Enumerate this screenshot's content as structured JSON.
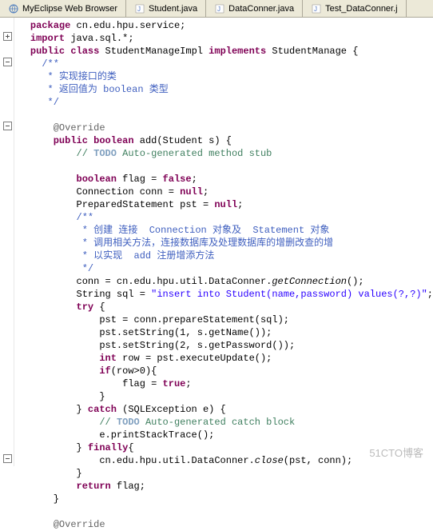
{
  "tabs": [
    {
      "label": "MyEclipse Web Browser"
    },
    {
      "label": "Student.java"
    },
    {
      "label": "DataConner.java"
    },
    {
      "label": "Test_DataConner.j"
    }
  ],
  "code": {
    "l1": {
      "kw": "package",
      "rest": " cn.edu.hpu.service;"
    },
    "l2": {
      "sym": "⊕",
      "kw": "import",
      "rest": " java.sql.*;"
    },
    "l3": {
      "kw1": "public",
      "kw2": "class",
      "name": " StudentManageImpl ",
      "kw3": "implements",
      "rest": " StudentManage {"
    },
    "jd1": "/**",
    "jd2": " * 实现接口的类",
    "jd3_a": " * 返回值为 ",
    "jd3_b": "boolean 类型",
    "jd4": " */",
    "ann": "@Override",
    "m1_a": "public",
    "m1_b": " boolean",
    "m1_c": " add(Student s) {",
    "c1_a": "// ",
    "c1_b": "TODO",
    "c1_c": " Auto-generated method stub",
    "b1_a": "boolean",
    "b1_b": " flag = ",
    "b1_c": "false",
    "b1_d": ";",
    "b2_a": "Connection conn = ",
    "b2_b": "null",
    "b2_c": ";",
    "b3_a": "PreparedStatement pst = ",
    "b3_b": "null",
    "b3_c": ";",
    "jd5": "/**",
    "jd6_a": " * 创建 连接  ",
    "jd6_b": "Connection 对象及  Statement 对象",
    "jd7": " * 调用相关方法，连接数据库及处理数据库的增删改查的增",
    "jd8_a": " * 以实现  ",
    "jd8_b": "add 注册增添方法",
    "jd9": " */",
    "s1_a": "conn = cn.edu.hpu.util.DataConner.",
    "s1_b": "getConnection",
    "s1_c": "();",
    "s2_a": "String sql = ",
    "s2_b": "\"insert into Student(name,password) values(?,?)\"",
    "s2_c": ";",
    "s3_a": "try",
    "s3_b": " {",
    "s4": "pst = conn.prepareStatement(sql);",
    "s5": "pst.setString(1, s.getName());",
    "s6": "pst.setString(2, s.getPassword());",
    "s7_a": "int",
    "s7_b": " row = pst.executeUpdate();",
    "s8_a": "if",
    "s8_b": "(row>0){",
    "s9_a": "flag = ",
    "s9_b": "true",
    "s9_c": ";",
    "cb1": "}",
    "s10_a": "} ",
    "s10_b": "catch",
    "s10_c": " (SQLException e) {",
    "c2_a": "// ",
    "c2_b": "TODO",
    "c2_c": " Auto-generated catch block",
    "s11": "e.printStackTrace();",
    "s12_a": "} ",
    "s12_b": "finally",
    "s12_c": "{",
    "s13_a": "cn.edu.hpu.util.DataConner.",
    "s13_b": "close",
    "s13_c": "(pst, conn);",
    "cb2": "}",
    "s14_a": "return",
    "s14_b": " flag;",
    "cb3": "}",
    "ann2": "@Override"
  },
  "watermark": "51CTO博客"
}
